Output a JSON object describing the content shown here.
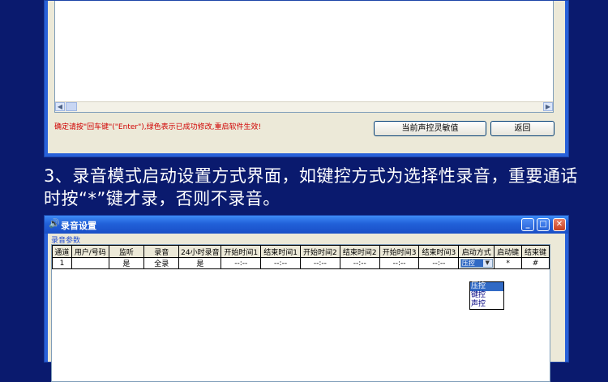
{
  "top_panel": {
    "hint": "确定请按\"回车键\"(\"Enter\"),绿色表示已成功修改,重启软件生效!",
    "sensitivity_button": "当前声控灵敏值",
    "back_button": "返回"
  },
  "description": "3、录音模式启动设置方式界面，如键控方式为选择性录音，重要通话时按“*”键才录，否则不录音。",
  "window": {
    "title": "录音设置",
    "group_label": "录音参数",
    "min_glyph": "_",
    "max_glyph": "□",
    "close_glyph": "✕",
    "columns": [
      "通道",
      "用户/号码",
      "监听",
      "录音",
      "24小时录音",
      "开始时间1",
      "结束时间1",
      "开始时间2",
      "结束时间2",
      "开始时间3",
      "结束时间3",
      "启动方式",
      "启动键",
      "结束键"
    ],
    "row": {
      "channel": "1",
      "user": "",
      "monitor": "是",
      "record": "全录",
      "record24": "是",
      "start1": "--:--",
      "end1": "--:--",
      "start2": "--:--",
      "end2": "--:--",
      "start3": "--:--",
      "end3": "--:--",
      "start_mode": "压控",
      "start_key": "*",
      "end_key": "#"
    },
    "dropdown_options": [
      "压控",
      "键控",
      "声控"
    ],
    "dropdown_selected": "压控"
  },
  "colors": {
    "background": "#0a1a6e",
    "hint_text": "#d00000",
    "xp_titlebar": "#2160d9",
    "selection": "#316ac5"
  },
  "icons": {
    "speaker": "speaker-icon",
    "scroll_left": "arrow-left-icon",
    "scroll_right": "arrow-right-icon",
    "combo": "chevron-down-icon"
  }
}
